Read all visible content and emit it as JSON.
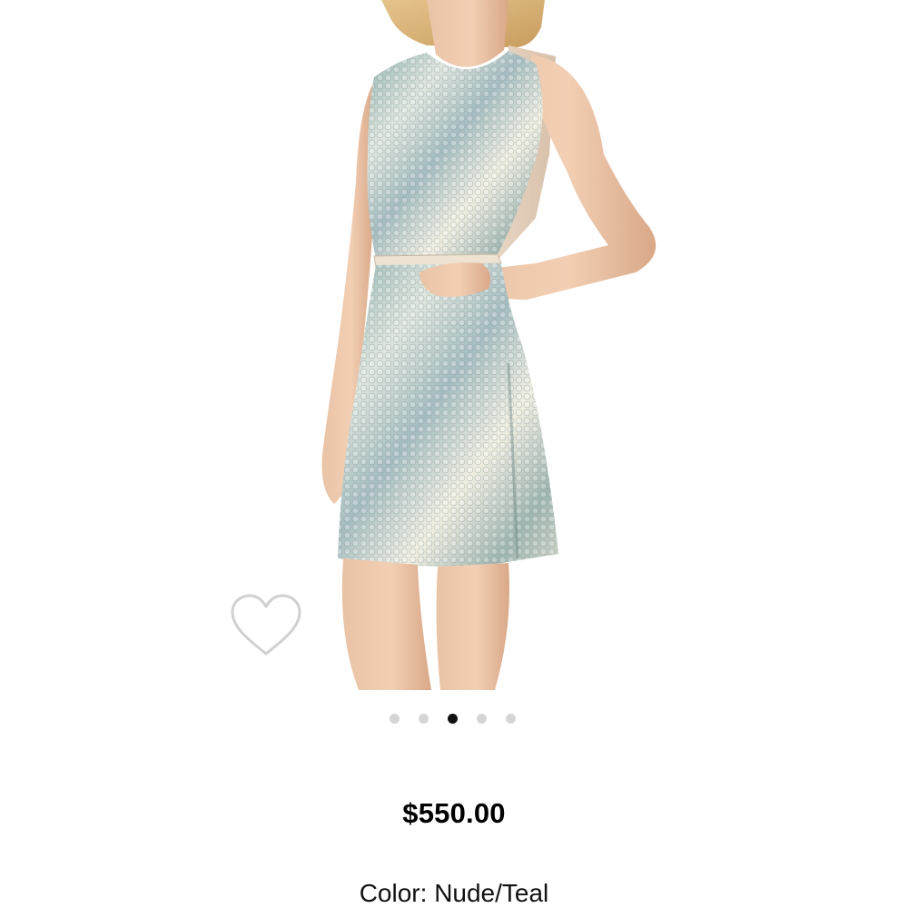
{
  "product": {
    "image_alt_icon": "product-photo-sequin-dress",
    "price": "$550.00",
    "color_label": "Color:",
    "color_value": "Nude/Teal"
  },
  "favorite": {
    "icon": "heart-outline-icon",
    "stroke_color": "#d0d0d0"
  },
  "carousel": {
    "total": 5,
    "active_index": 2,
    "dot_color": "#d5d5d5",
    "active_color": "#111111"
  }
}
